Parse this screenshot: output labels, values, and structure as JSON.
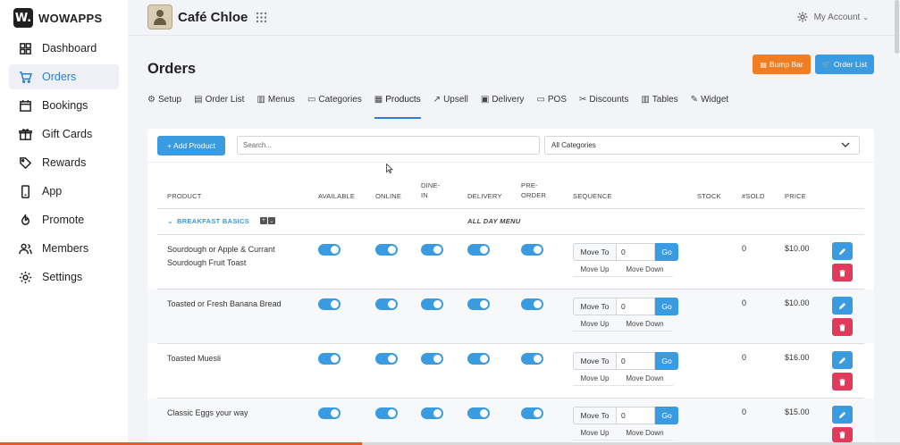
{
  "brand": {
    "logo": "W.",
    "name": "WOWAPPS"
  },
  "sidebar": {
    "items": [
      {
        "label": "Dashboard",
        "icon": "dashboard-icon"
      },
      {
        "label": "Orders",
        "icon": "cart-icon",
        "active": true
      },
      {
        "label": "Bookings",
        "icon": "calendar-icon"
      },
      {
        "label": "Gift Cards",
        "icon": "gift-icon"
      },
      {
        "label": "Rewards",
        "icon": "tag-icon"
      },
      {
        "label": "App",
        "icon": "phone-icon"
      },
      {
        "label": "Promote",
        "icon": "flame-icon"
      },
      {
        "label": "Members",
        "icon": "members-icon"
      },
      {
        "label": "Settings",
        "icon": "gear-icon"
      }
    ]
  },
  "header": {
    "cafe_name": "Café Chloe",
    "account_label": "My Account"
  },
  "page": {
    "title": "Orders",
    "bump_bar": "Bump Bar",
    "order_list": "Order List"
  },
  "tabs": [
    {
      "label": "Setup",
      "icon": "⚙"
    },
    {
      "label": "Order List",
      "icon": "▤"
    },
    {
      "label": "Menus",
      "icon": "▥"
    },
    {
      "label": "Categories",
      "icon": "▭"
    },
    {
      "label": "Products",
      "icon": "▦",
      "active": true
    },
    {
      "label": "Upsell",
      "icon": "↗"
    },
    {
      "label": "Delivery",
      "icon": "▣"
    },
    {
      "label": "POS",
      "icon": "▭"
    },
    {
      "label": "Discounts",
      "icon": "✂"
    },
    {
      "label": "Tables",
      "icon": "▥"
    },
    {
      "label": "Widget",
      "icon": "✎"
    }
  ],
  "toolbar": {
    "add_product": "+ Add Product",
    "search_placeholder": "Search...",
    "category_select": "All Categories"
  },
  "table": {
    "columns": {
      "product": "PRODUCT",
      "available": "AVAILABLE",
      "online": "ONLINE",
      "dinein_1": "DINE-",
      "dinein_2": "IN",
      "delivery": "DELIVERY",
      "preorder_1": "PRE-",
      "preorder_2": "ORDER",
      "sequence": "SEQUENCE",
      "stock": "STOCK",
      "sold": "#SOLD",
      "price": "PRICE"
    },
    "category": {
      "name": "BREAKFAST BASICS",
      "menu": "ALL DAY MENU"
    },
    "sequence_labels": {
      "move_to": "Move To",
      "go": "Go",
      "move_up": "Move Up",
      "move_down": "Move Down"
    },
    "rows": [
      {
        "name": "Sourdough or Apple & Currant Sourdough Fruit Toast",
        "seq": "0",
        "sold": "0",
        "price": "$10.00"
      },
      {
        "name": "Toasted or Fresh Banana Bread",
        "seq": "0",
        "sold": "0",
        "price": "$10.00"
      },
      {
        "name": "Toasted Muesli",
        "seq": "0",
        "sold": "0",
        "price": "$16.00"
      },
      {
        "name": "Classic Eggs your way",
        "seq": "0",
        "sold": "0",
        "price": "$15.00"
      }
    ]
  },
  "colors": {
    "primary": "#3a9be0",
    "orange": "#f07d22",
    "danger": "#e23a5a"
  }
}
